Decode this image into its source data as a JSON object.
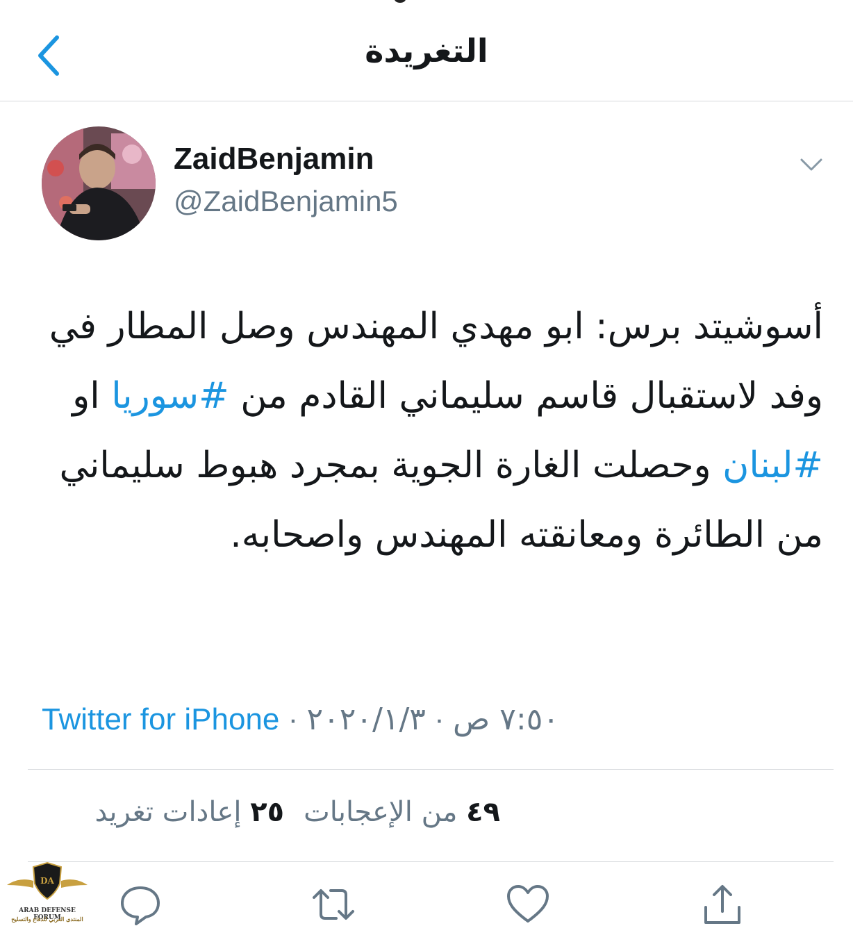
{
  "header": {
    "title": "التغريدة"
  },
  "user": {
    "display_name": "ZaidBenjamin",
    "handle": "@ZaidBenjamin5"
  },
  "tweet": {
    "parts": [
      "أسوشيتد برس: ابو مهدي المهندس وصل المطار في وفد لاستقبال قاسم سليماني القادم من ",
      "#سوريا",
      " او ",
      "#لبنان",
      " وحصلت الغارة الجوية بمجرد هبوط سليماني من الطائرة ومعانقته المهندس واصحابه."
    ]
  },
  "meta": {
    "time": "٧:٥٠ ص",
    "sep1": " · ",
    "date": "٢٠٢٠/١/٣",
    "sep2": " · ",
    "source": "Twitter for iPhone"
  },
  "stats": {
    "retweets_count": "٢٥",
    "retweets_label": "إعادات تغريد",
    "likes_count": "٤٩",
    "likes_label": "من الإعجابات"
  },
  "actions": [
    "reply-icon",
    "retweet-icon",
    "like-icon",
    "share-icon"
  ],
  "watermark": {
    "title": "ARAB DEFENSE FORUM",
    "subtitle": "المنتدى العربي للدفاع والتسليح",
    "badge": "DA"
  },
  "colors": {
    "link": "#1b95e0",
    "secondary": "#657786",
    "divider": "#d6d9dc"
  }
}
